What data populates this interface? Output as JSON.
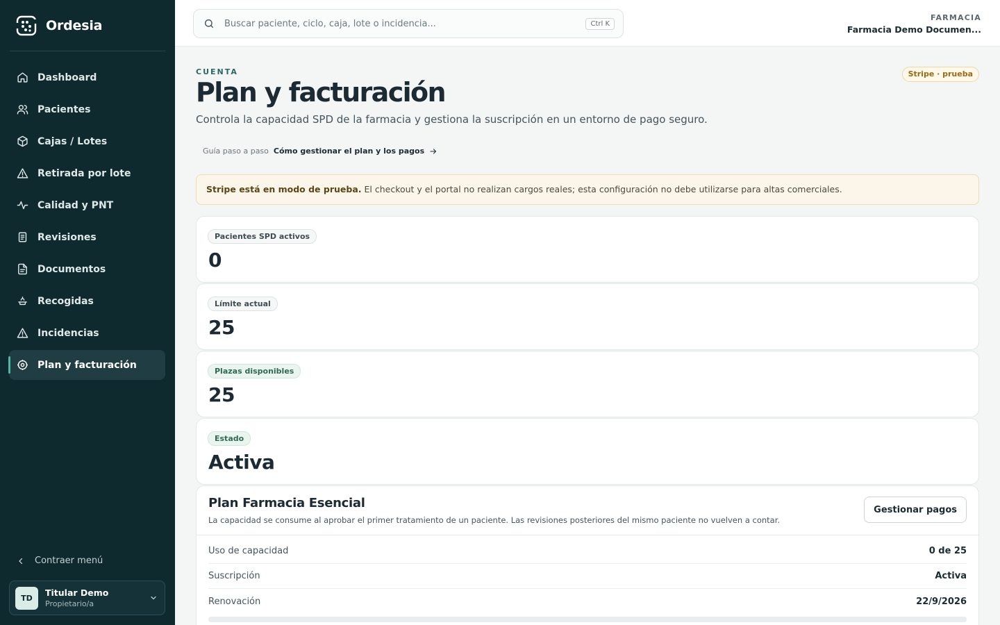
{
  "brand": {
    "name": "Ordesia"
  },
  "sidebar": {
    "items": [
      {
        "label": "Dashboard",
        "icon": "home-icon"
      },
      {
        "label": "Pacientes",
        "icon": "users-icon"
      },
      {
        "label": "Cajas / Lotes",
        "icon": "box-icon"
      },
      {
        "label": "Retirada por lote",
        "icon": "warning-icon"
      },
      {
        "label": "Calidad y PNT",
        "icon": "activity-icon"
      },
      {
        "label": "Revisiones",
        "icon": "clipboard-icon"
      },
      {
        "label": "Documentos",
        "icon": "document-icon"
      },
      {
        "label": "Recogidas",
        "icon": "pickup-icon"
      },
      {
        "label": "Incidencias",
        "icon": "warning-icon"
      },
      {
        "label": "Plan y facturación",
        "icon": "gear-icon",
        "active": true
      }
    ],
    "collapse_label": "Contraer menú",
    "user": {
      "initials": "TD",
      "name": "Titular Demo",
      "role": "Propietario/a"
    }
  },
  "topbar": {
    "search_placeholder": "Buscar paciente, ciclo, caja, lote o incidencia...",
    "shortcut": "Ctrl K",
    "pharmacy_label": "FARMACIA",
    "pharmacy_name": "Farmacia Demo Documen..."
  },
  "header": {
    "eyebrow": "CUENTA",
    "title": "Plan y facturación",
    "subtitle": "Controla la capacidad SPD de la farmacia y gestiona la suscripción en un entorno de pago seguro.",
    "badge": "Stripe · prueba",
    "guide_label": "Guía paso a paso",
    "guide_link": "Cómo gestionar el plan y los pagos"
  },
  "alert": {
    "strong": "Stripe está en modo de prueba.",
    "text": " El checkout y el portal no realizan cargos reales; esta configuración no debe utilizarse para altas comerciales."
  },
  "stats": [
    {
      "label": "Pacientes SPD activos",
      "value": "0"
    },
    {
      "label": "Límite actual",
      "value": "25"
    },
    {
      "label": "Plazas disponibles",
      "value": "25"
    },
    {
      "label": "Estado",
      "value": "Activa"
    }
  ],
  "plan": {
    "title": "Plan Farmacia Esencial",
    "description": "La capacidad se consume al aprobar el primer tratamiento de un paciente. Las revisiones posteriores del mismo paciente no vuelven a contar.",
    "button": "Gestionar pagos",
    "rows": [
      {
        "key": "Uso de capacidad",
        "value": "0 de 25"
      },
      {
        "key": "Suscripción",
        "value": "Activa"
      },
      {
        "key": "Renovación",
        "value": "22/9/2026"
      }
    ],
    "usage_fraction": 0
  },
  "colors": {
    "sidebar_bg": "#0e2a2f",
    "accent": "#2a6a63",
    "warning_bg": "#fcf6ea"
  }
}
